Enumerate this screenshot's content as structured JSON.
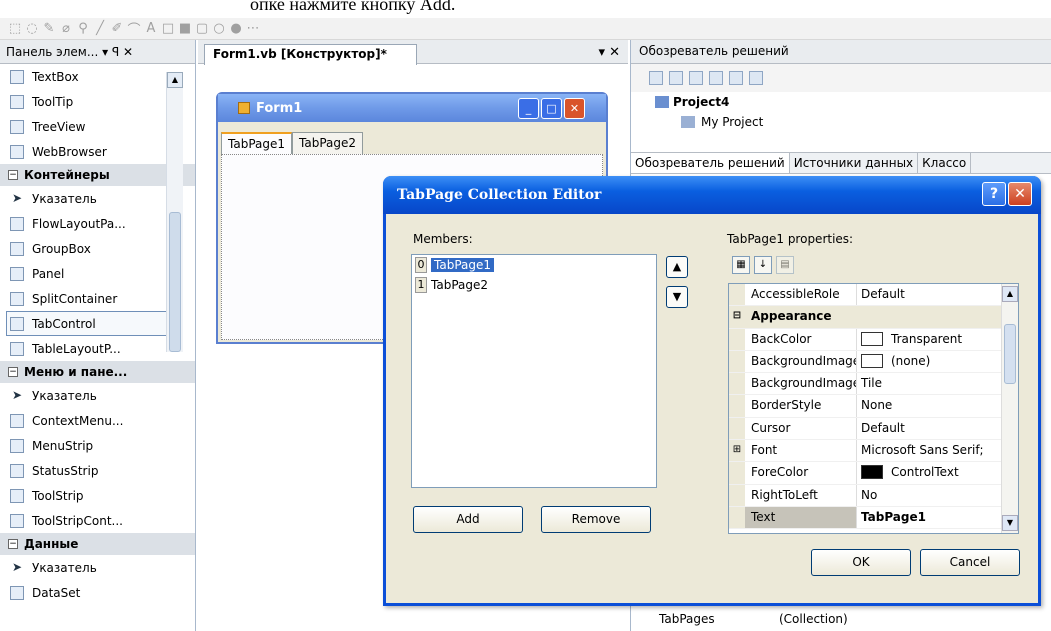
{
  "doc_text": "опке нажмите кнопку Add.",
  "toolbox": {
    "title": "Панель элем... ▾ ꟼ ✕",
    "items_top": [
      {
        "label": "TextBox",
        "icon": "textbox-icon"
      },
      {
        "label": "ToolTip",
        "icon": "tooltip-icon"
      },
      {
        "label": "TreeView",
        "icon": "treeview-icon"
      },
      {
        "label": "WebBrowser",
        "icon": "webbrowser-icon"
      }
    ],
    "cat_containers": "Контейнеры",
    "items_containers": [
      {
        "label": "Указатель"
      },
      {
        "label": "FlowLayoutPa..."
      },
      {
        "label": "GroupBox"
      },
      {
        "label": "Panel"
      },
      {
        "label": "SplitContainer"
      },
      {
        "label": "TabControl"
      },
      {
        "label": "TableLayoutP..."
      }
    ],
    "cat_menus": "Меню и пане...",
    "items_menus": [
      {
        "label": "Указатель"
      },
      {
        "label": "ContextMenu..."
      },
      {
        "label": "MenuStrip"
      },
      {
        "label": "StatusStrip"
      },
      {
        "label": "ToolStrip"
      },
      {
        "label": "ToolStripCont..."
      }
    ],
    "cat_data": "Данные",
    "items_data": [
      {
        "label": "Указатель"
      },
      {
        "label": "DataSet"
      }
    ]
  },
  "designer": {
    "tab": "Form1.vb [Конструктор]*",
    "tab_ctl": "▾ ✕",
    "form_title": "Form1",
    "tabs": [
      "TabPage1",
      "TabPage2"
    ]
  },
  "solution": {
    "title": "Обозреватель решений",
    "project": "Project4",
    "my_project": "My Project",
    "bottom_tabs": [
      "Обозреватель решений",
      "Источники данных",
      "Классо"
    ],
    "bottom_prop_name": "TabPages",
    "bottom_prop_value": "(Collection)"
  },
  "dialog": {
    "title": "TabPage Collection Editor",
    "members_label": "Members:",
    "members": [
      {
        "idx": "0",
        "name": "TabPage1"
      },
      {
        "idx": "1",
        "name": "TabPage2"
      }
    ],
    "add": "Add",
    "remove": "Remove",
    "props_label": "TabPage1 properties:",
    "properties": [
      {
        "name": "AccessibleRole",
        "value": "Default"
      },
      {
        "cat": "Appearance"
      },
      {
        "name": "BackColor",
        "value": "Transparent",
        "swatch": "#ffffff"
      },
      {
        "name": "BackgroundImage",
        "value": "(none)",
        "swatch": "#ffffff"
      },
      {
        "name": "BackgroundImage",
        "value": "Tile"
      },
      {
        "name": "BorderStyle",
        "value": "None"
      },
      {
        "name": "Cursor",
        "value": "Default"
      },
      {
        "name": "Font",
        "value": "Microsoft Sans Serif;",
        "expand": "⊞"
      },
      {
        "name": "ForeColor",
        "value": "ControlText",
        "swatch": "#000000"
      },
      {
        "name": "RightToLeft",
        "value": "No"
      },
      {
        "name": "Text",
        "value": "TabPage1",
        "selected": true
      }
    ],
    "ok": "OK",
    "cancel": "Cancel"
  }
}
